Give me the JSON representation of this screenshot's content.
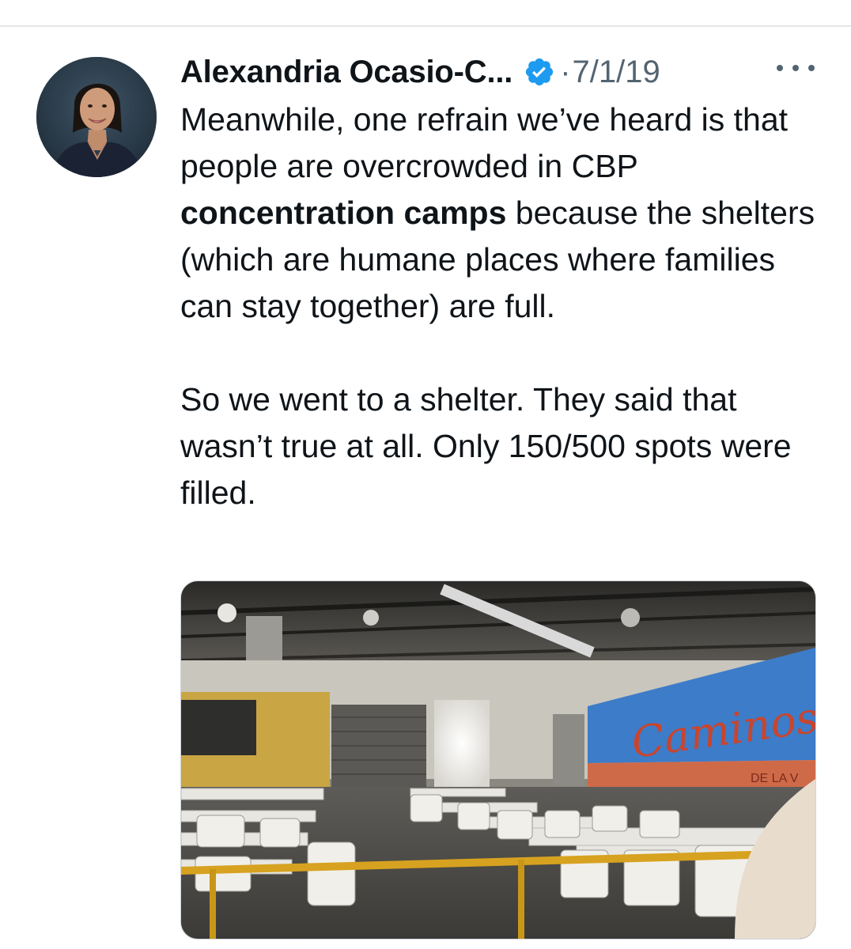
{
  "tweet": {
    "author_name": "Alexandria Ocasio-C...",
    "separator": "·",
    "date": "7/1/19",
    "text_part1_before": "Meanwhile, one refrain we’ve heard is that people are overcrowded in CBP ",
    "text_part1_bold": "concentration camps",
    "text_part1_after": " because the shelters (which are humane places where families can stay together) are full.",
    "text_part2": "So we went to a shelter. They said that wasn’t true at all. Only 150/500 spots were filled.",
    "mural_text": "Caminos",
    "mural_subtext": "DE LA V"
  },
  "icons": {
    "verified": "verified-badge-icon",
    "more": "more-options-icon"
  },
  "colors": {
    "verified_blue": "#1d9bf0",
    "text_primary": "#0f1419",
    "text_secondary": "#536471",
    "mural_blue": "#3d7cc9",
    "mural_red": "#c8452e"
  }
}
